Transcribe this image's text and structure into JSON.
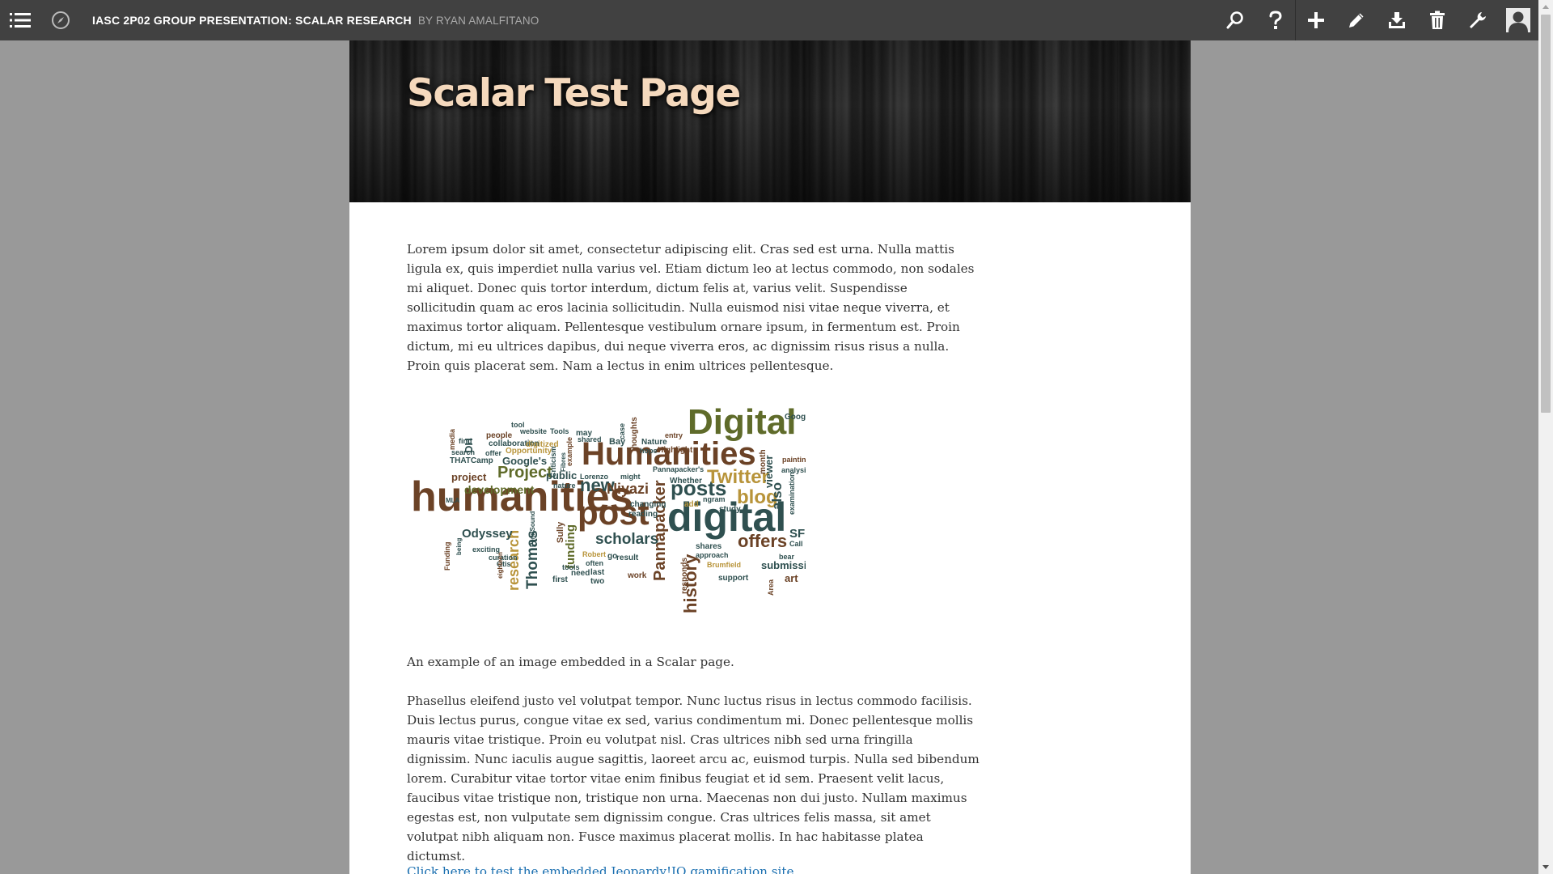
{
  "topbar": {
    "book_title": "IASC 2P02 GROUP PRESENTATION: SCALAR RESEARCH",
    "byline": "BY RYAN AMALFITANO",
    "icons_left": [
      "menu-icon",
      "compass-icon"
    ],
    "icons_right": [
      "search-icon",
      "help-icon",
      "add-icon",
      "edit-icon",
      "import-icon",
      "delete-icon",
      "dashboard-icon",
      "user-icon"
    ]
  },
  "page": {
    "title": "Scalar Test Page",
    "paragraph_1": "Lorem ipsum dolor sit amet, consectetur adipiscing elit. Cras sed est urna. Nulla mattis ligula ex, quis imperdiet nulla varius vel. Etiam dictum leo at lectus commodo, non sodales mi aliquet. Donec quis tortor interdum, dictum felis at, varius velit. Suspendisse sollicitudin quam ac eros lacinia sollicitudin. Nulla euismod nisi vitae neque viverra, et maximus tortor aliquam. Pellentesque vestibulum ornare ipsum, in fermentum est. Proin dictum, mi eu ultrices dapibus, dui neque viverra eros, ac dignissim risus risus a nulla. Proin quis placerat sem. Nam a lectus in enim ultrices pellentesque.",
    "image_caption": "An example of an image embedded in a Scalar page.",
    "paragraph_2": "Phasellus eleifend justo vel volutpat tempor. Nunc luctus risus in lectus commodo facilisis. Duis lectus purus, congue vitae ex sed, varius condimentum mi. Donec pellentesque mollis mauris vitae tristique. Proin eu volutpat nisl. Cras ultrices nibh sed urna fringilla dignissim. Nunc iaculis augue sagittis, laoreet arcu ac, euismod turpis. Nulla sed bibendum lorem. Curabitur vitae tortor vitae enim finibus feugiat et id sem. Praesent velit lacus, faucibus vitae tristique non, tristique non urna. Maecenas non dui justo. Nullam maximus egestas est, non vulputate sem dignissim congue. Cras ultrices felis massa, sit amet volutpat nibh aliquam non. Fusce maximus placerat mollis. In hac habitasse platea dictumst.",
    "link_text": "Click here to test the embedded Jeopardy!IO gamification site"
  },
  "colors": {
    "topbar": "#414141",
    "background": "#999999",
    "title": "#f5d9bd",
    "link": "#1a6fb0"
  },
  "word_cloud": {
    "words": [
      {
        "text": "humanities",
        "color": "#6b4226"
      },
      {
        "text": "Humanities",
        "color": "#6b4226"
      },
      {
        "text": "digital",
        "color": "#2f5050"
      },
      {
        "text": "Digital",
        "color": "#5f6b2a"
      },
      {
        "text": "post",
        "color": "#6b4226"
      },
      {
        "text": "posts",
        "color": "#2f5050"
      },
      {
        "text": "Twitter",
        "color": "#b8943a"
      },
      {
        "text": "blog",
        "color": "#b8943a"
      },
      {
        "text": "offers",
        "color": "#6b4226"
      },
      {
        "text": "scholars",
        "color": "#2f5050"
      },
      {
        "text": "research",
        "color": "#b8943a"
      },
      {
        "text": "Thomas",
        "color": "#2f5050"
      },
      {
        "text": "Pannapacker",
        "color": "#6b4226"
      },
      {
        "text": "history",
        "color": "#6b4226"
      },
      {
        "text": "Project",
        "color": "#5f6b2a"
      },
      {
        "text": "new",
        "color": "#2f5050"
      },
      {
        "text": "Niyazi",
        "color": "#6b4226"
      },
      {
        "text": "development",
        "color": "#5f6b2a"
      },
      {
        "text": "Odyssey",
        "color": "#2f5050"
      },
      {
        "text": "project",
        "color": "#6b4226"
      },
      {
        "text": "Google's",
        "color": "#2f5050"
      },
      {
        "text": "public",
        "color": "#2f5050"
      },
      {
        "text": "submission",
        "color": "#2f5050"
      },
      {
        "text": "also",
        "color": "#2f5050"
      },
      {
        "text": "funding",
        "color": "#5f6b2a"
      },
      {
        "text": "art",
        "color": "#6b4226"
      },
      {
        "text": "Opportunity",
        "color": "#b8943a"
      },
      {
        "text": "collaboration",
        "color": "#2f5050"
      },
      {
        "text": "people",
        "color": "#6b4226"
      },
      {
        "text": "website",
        "color": "#2f5050"
      },
      {
        "text": "Tools",
        "color": "#2f5050"
      },
      {
        "text": "Nature",
        "color": "#2f5050"
      },
      {
        "text": "Highlight",
        "color": "#6b4226"
      },
      {
        "text": "viewer",
        "color": "#2f5050"
      },
      {
        "text": "analysis",
        "color": "#2f5050"
      },
      {
        "text": "Google",
        "color": "#2f5050"
      },
      {
        "text": "study",
        "color": "#2f5050"
      },
      {
        "text": "approach",
        "color": "#2f5050"
      },
      {
        "text": "shares",
        "color": "#2f5050"
      },
      {
        "text": "support",
        "color": "#2f5050"
      },
      {
        "text": "Brumfield",
        "color": "#b8943a"
      },
      {
        "text": "Whether",
        "color": "#2f5050"
      },
      {
        "text": "changing",
        "color": "#2f5050"
      },
      {
        "text": "reading",
        "color": "#2f5050"
      },
      {
        "text": "tools",
        "color": "#2f5050"
      },
      {
        "text": "often",
        "color": "#2f5050"
      },
      {
        "text": "last",
        "color": "#2f5050"
      },
      {
        "text": "two",
        "color": "#2f5050"
      },
      {
        "text": "first",
        "color": "#2f5050"
      },
      {
        "text": "need",
        "color": "#2f5050"
      },
      {
        "text": "work",
        "color": "#6b4226"
      },
      {
        "text": "might",
        "color": "#2f5050"
      },
      {
        "text": "Lorenzo",
        "color": "#2f5050"
      },
      {
        "text": "nature",
        "color": "#2f5050"
      },
      {
        "text": "search",
        "color": "#2f5050"
      },
      {
        "text": "THATCamp",
        "color": "#2f5050"
      },
      {
        "text": "offer",
        "color": "#2f5050"
      },
      {
        "text": "find",
        "color": "#2f5050"
      },
      {
        "text": "DH",
        "color": "#2f5050"
      },
      {
        "text": "media",
        "color": "#6b4226"
      },
      {
        "text": "shared",
        "color": "#2f5050"
      },
      {
        "text": "may",
        "color": "#2f5050"
      },
      {
        "text": "tool",
        "color": "#2f5050"
      },
      {
        "text": "Bay",
        "color": "#2f5050"
      },
      {
        "text": "hope",
        "color": "#2f5050"
      },
      {
        "text": "entry",
        "color": "#6b4226"
      },
      {
        "text": "month",
        "color": "#6b4226"
      },
      {
        "text": "painting",
        "color": "#6b4226"
      },
      {
        "text": "SF",
        "color": "#2f5050"
      },
      {
        "text": "Call",
        "color": "#2f5050"
      },
      {
        "text": "bear",
        "color": "#2f5050"
      },
      {
        "text": "Robert",
        "color": "#b8943a"
      },
      {
        "text": "curation",
        "color": "#2f5050"
      },
      {
        "text": "exciting",
        "color": "#2f5050"
      },
      {
        "text": "Otis",
        "color": "#2f5050"
      },
      {
        "text": "eighteen",
        "color": "#6b4226"
      },
      {
        "text": "Sully",
        "color": "#6b4226"
      },
      {
        "text": "responds",
        "color": "#6b4226"
      },
      {
        "text": "Pannapacker's",
        "color": "#2f5050"
      },
      {
        "text": "result",
        "color": "#2f5050"
      },
      {
        "text": "go",
        "color": "#2f5050"
      },
      {
        "text": "add",
        "color": "#b8943a"
      },
      {
        "text": "ngram",
        "color": "#2f5050"
      },
      {
        "text": "examination",
        "color": "#2f5050"
      },
      {
        "text": "MLA",
        "color": "#2f5050"
      },
      {
        "text": "digitized",
        "color": "#b8943a"
      },
      {
        "text": "Criticism",
        "color": "#2f5050"
      },
      {
        "text": "Fibres",
        "color": "#2f5050"
      },
      {
        "text": "example",
        "color": "#6b4226"
      },
      {
        "text": "thoughts",
        "color": "#6b4226"
      },
      {
        "text": "case",
        "color": "#2f5050"
      },
      {
        "text": "Funding",
        "color": "#6b4226"
      },
      {
        "text": "being",
        "color": "#2f5050"
      },
      {
        "text": "Area",
        "color": "#6b4226"
      },
      {
        "text": "PennSound",
        "color": "#2f5050"
      }
    ]
  }
}
